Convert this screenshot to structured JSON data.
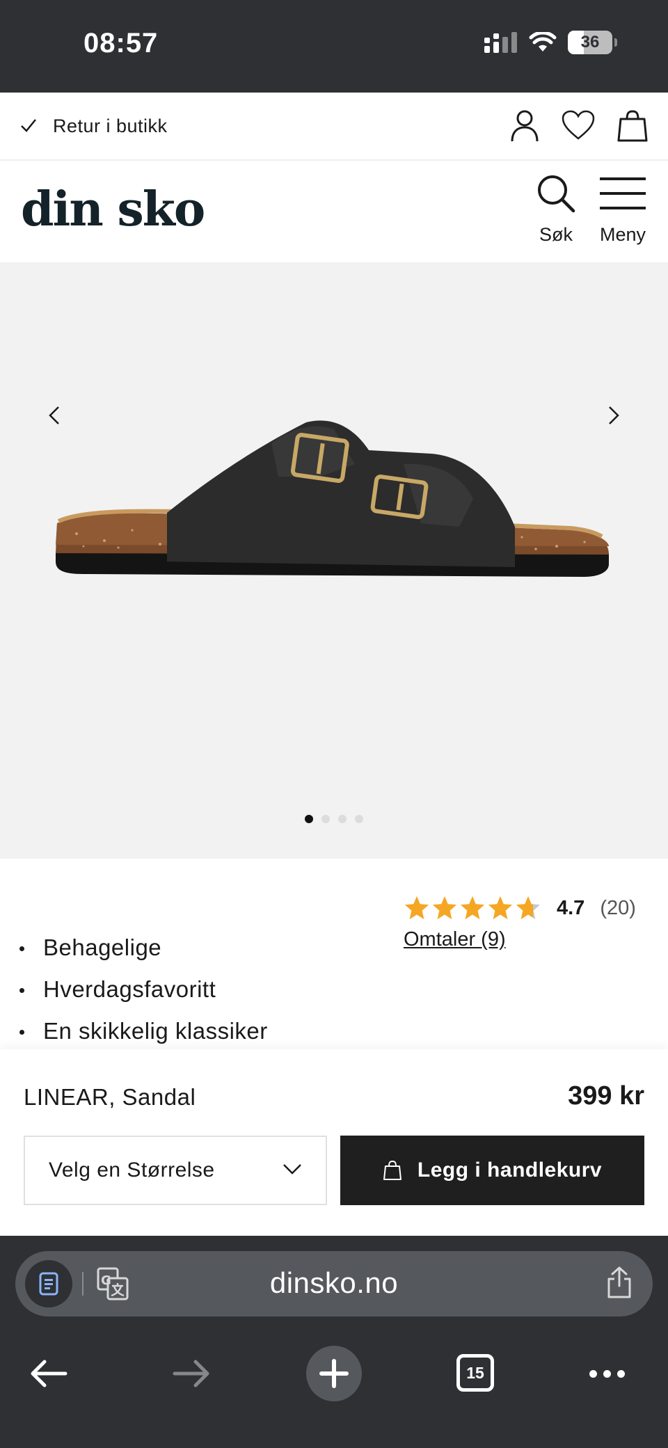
{
  "status": {
    "time": "08:57",
    "battery": "36",
    "battery_level": 0.36
  },
  "topbar": {
    "retur_text": "Retur i butikk"
  },
  "header": {
    "logo": "din sko",
    "search_label": "Søk",
    "menu_label": "Meny"
  },
  "gallery": {
    "image_count": 4,
    "active_index": 0
  },
  "product": {
    "bullets": [
      "Behagelige",
      "Hverdagsfavoritt",
      "En skikkelig klassiker"
    ],
    "rating": "4.7",
    "rating_value": 4.7,
    "rating_count": "(20)",
    "reviews_link": "Omtaler (9)",
    "name": "LINEAR, Sandal",
    "price": "399 kr"
  },
  "buy": {
    "size_placeholder": "Velg en Størrelse",
    "add_to_cart": "Legg i handlekurv"
  },
  "browser": {
    "url": "dinsko.no",
    "tab_count": "15"
  },
  "colors": {
    "chrome": "#2e3033",
    "star": "#f5a623",
    "button": "#1f1f1f",
    "gallery_bg": "#f2f2f2"
  }
}
